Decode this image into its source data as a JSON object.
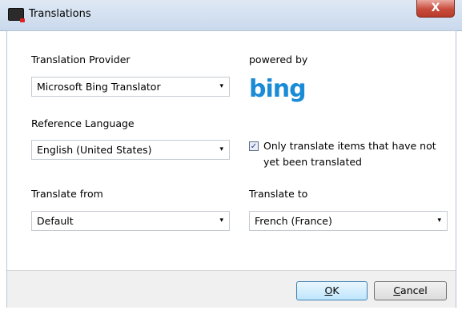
{
  "window": {
    "title": "Translations",
    "close_glyph": "X"
  },
  "provider": {
    "label": "Translation Provider",
    "value": "Microsoft Bing Translator"
  },
  "powered_by": {
    "label": "powered by",
    "logo_text": "bing"
  },
  "reference": {
    "label": "Reference Language",
    "value": "English (United States)"
  },
  "option": {
    "checked": true,
    "label_line1": "Only translate items that have not",
    "label_line2": "yet been translated"
  },
  "translate_from": {
    "label": "Translate from",
    "value": "Default"
  },
  "translate_to": {
    "label": "Translate to",
    "value": "French (France)"
  },
  "buttons": {
    "ok_mnemonic": "O",
    "ok_rest": "K",
    "cancel_mnemonic": "C",
    "cancel_rest": "ancel"
  },
  "icons": {
    "dropdown_arrow": "▾",
    "check": "✓"
  },
  "colors": {
    "bing_blue": "#1a8bd6",
    "close_red": "#c84c3c",
    "ok_blue": "#3c7fb1"
  }
}
